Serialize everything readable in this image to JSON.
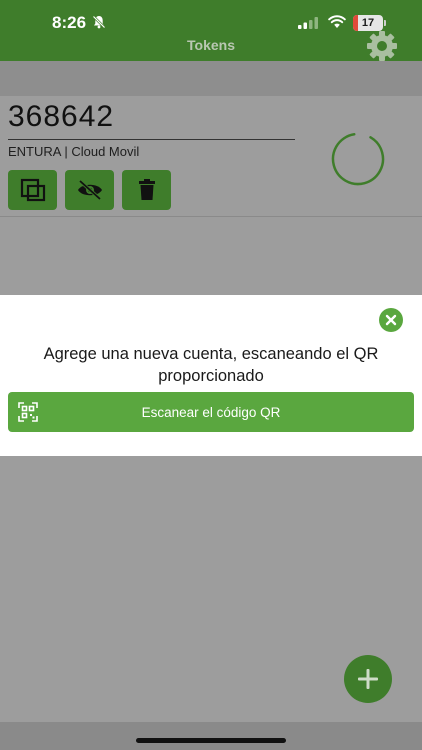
{
  "status_bar": {
    "time": "8:26",
    "battery_level": "17",
    "battery_fraction": 0.17
  },
  "header": {
    "title": "Tokens"
  },
  "token": {
    "code": "368642",
    "account": "ENTURA | Cloud Movil",
    "actions": [
      "copy-icon",
      "hide-icon",
      "trash-icon"
    ]
  },
  "dialog": {
    "message": "Agrege una nueva cuenta, escaneando el QR proporcionado",
    "scan_button_label": "Escanear el código QR"
  },
  "colors": {
    "header_green": "#3f7d2b",
    "accent_green": "#5aa73f",
    "overlay_gray": "#9d9d9d",
    "battery_red": "#e04a3a"
  }
}
